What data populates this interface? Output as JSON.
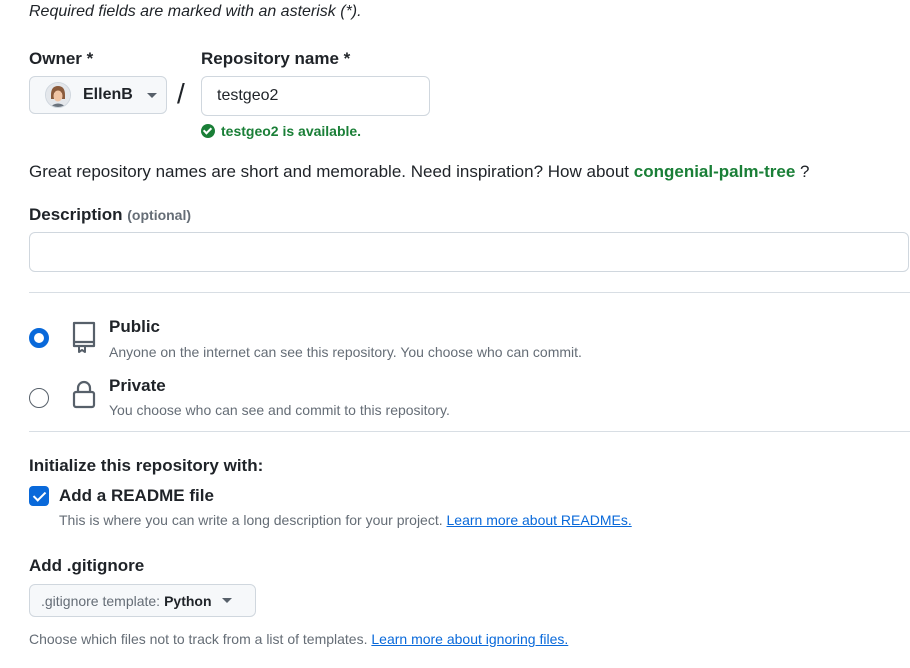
{
  "form": {
    "required_note": "Required fields are marked with an asterisk (*).",
    "owner": {
      "label": "Owner *",
      "name": "EllenB"
    },
    "separator": "/",
    "repo_name": {
      "label": "Repository name *",
      "value": "testgeo2",
      "availability": "testgeo2 is available."
    },
    "inspiration": {
      "prefix": "Great repository names are short and memorable. Need inspiration? How about ",
      "suggestion": "congenial-palm-tree",
      "suffix": " ?"
    },
    "description": {
      "label": "Description",
      "optional": "(optional)",
      "value": ""
    },
    "visibility": {
      "selected": "Public",
      "options": [
        {
          "title": "Public",
          "description": "Anyone on the internet can see this repository. You choose who can commit.",
          "icon": "repo-icon"
        },
        {
          "title": "Private",
          "description": "You choose who can see and commit to this repository.",
          "icon": "lock-icon"
        }
      ]
    },
    "initialize": {
      "title": "Initialize this repository with:",
      "readme": {
        "label": "Add a README file",
        "checked": true,
        "description": "This is where you can write a long description for your project. ",
        "link": "Learn more about READMEs."
      }
    },
    "gitignore": {
      "label": "Add .gitignore",
      "template_prefix": ".gitignore template:",
      "template_value": "Python",
      "description": "Choose which files not to track from a list of templates. ",
      "link": "Learn more about ignoring files."
    }
  },
  "colors": {
    "accent": "#0969da",
    "success": "#1a7f37",
    "muted_text": "#656d76",
    "border": "#d0d7de"
  }
}
